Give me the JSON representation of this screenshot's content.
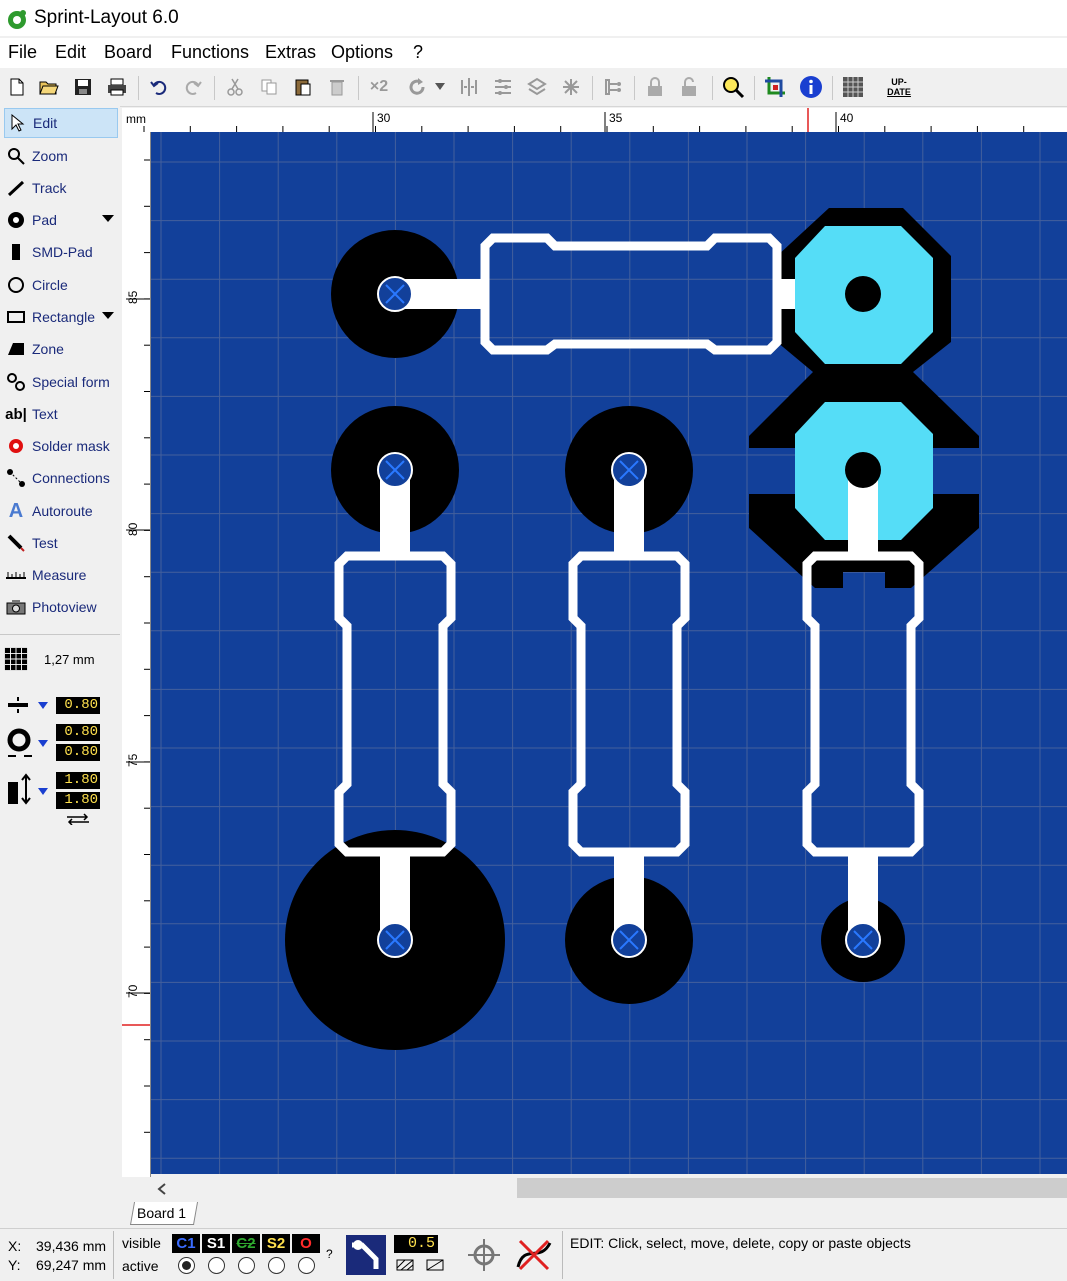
{
  "window": {
    "title": "Sprint-Layout 6.0"
  },
  "menu": [
    "File",
    "Edit",
    "Board",
    "Functions",
    "Extras",
    "Options",
    "?"
  ],
  "toolbar": {
    "icons": [
      "new-file-icon",
      "open-folder-icon",
      "save-icon",
      "print-icon",
      "undo-icon",
      "redo-icon",
      "cut-icon",
      "copy-icon",
      "paste-icon",
      "delete-icon",
      "x2-icon",
      "rotate-icon",
      "mirror-icon",
      "align-icon",
      "group-icon",
      "ungroup-icon",
      "lock-icon",
      "unlock-icon",
      "zoom-icon",
      "drc-icon",
      "info-icon",
      "pcb-chip-icon",
      "update-icon"
    ],
    "x2_label": "×2",
    "update_label_line1": "UP-",
    "update_label_line2": "DATE"
  },
  "tools": [
    {
      "label": "Edit",
      "icon": "pointer-icon",
      "active": true
    },
    {
      "label": "Zoom",
      "icon": "magnifier-icon"
    },
    {
      "label": "Track",
      "icon": "track-icon"
    },
    {
      "label": "Pad",
      "icon": "pad-icon",
      "dropdown": true
    },
    {
      "label": "SMD-Pad",
      "icon": "smd-pad-icon"
    },
    {
      "label": "Circle",
      "icon": "circle-icon"
    },
    {
      "label": "Rectangle",
      "icon": "rectangle-icon",
      "dropdown": true
    },
    {
      "label": "Zone",
      "icon": "zone-icon"
    },
    {
      "label": "Special form",
      "icon": "special-form-icon"
    },
    {
      "label": "Text",
      "icon": "text-icon"
    },
    {
      "label": "Solder mask",
      "icon": "solder-mask-icon"
    },
    {
      "label": "Connections",
      "icon": "connections-icon"
    },
    {
      "label": "Autoroute",
      "icon": "autoroute-icon"
    },
    {
      "label": "Test",
      "icon": "test-icon"
    },
    {
      "label": "Measure",
      "icon": "measure-icon"
    },
    {
      "label": "Photoview",
      "icon": "camera-icon"
    }
  ],
  "grid": {
    "label": "1,27 mm"
  },
  "params": {
    "track_width": "0.80",
    "pad_outer": "0.80",
    "pad_inner": "0.80",
    "smd_w": "1.80",
    "smd_h": "1.80"
  },
  "ruler": {
    "unit": "mm",
    "top_labels": [
      "30",
      "35",
      "40"
    ],
    "left_labels": [
      "85",
      "80",
      "75",
      "70"
    ]
  },
  "tab": {
    "label": "Board 1"
  },
  "status": {
    "x_label": "X:",
    "x_value": "39,436 mm",
    "y_label": "Y:",
    "y_value": "69,247 mm",
    "visible_label": "visible",
    "active_label": "active",
    "layers": [
      {
        "label": "C1",
        "color": "#3b6cff"
      },
      {
        "label": "S1",
        "color": "#ffffff"
      },
      {
        "label": "C2",
        "color": "#2faa2f"
      },
      {
        "label": "S2",
        "color": "#ffe14d"
      },
      {
        "label": "O",
        "color": "#ff2a2a"
      }
    ],
    "help_mark": "?",
    "zoom_value": "0.5",
    "message": "EDIT:  Click, select, move, delete, copy or paste objects"
  },
  "colors": {
    "board": "#12409a",
    "copper": "#000000",
    "silk": "#ffffff",
    "selected": "#55ddf7",
    "grid": "#44609c"
  }
}
